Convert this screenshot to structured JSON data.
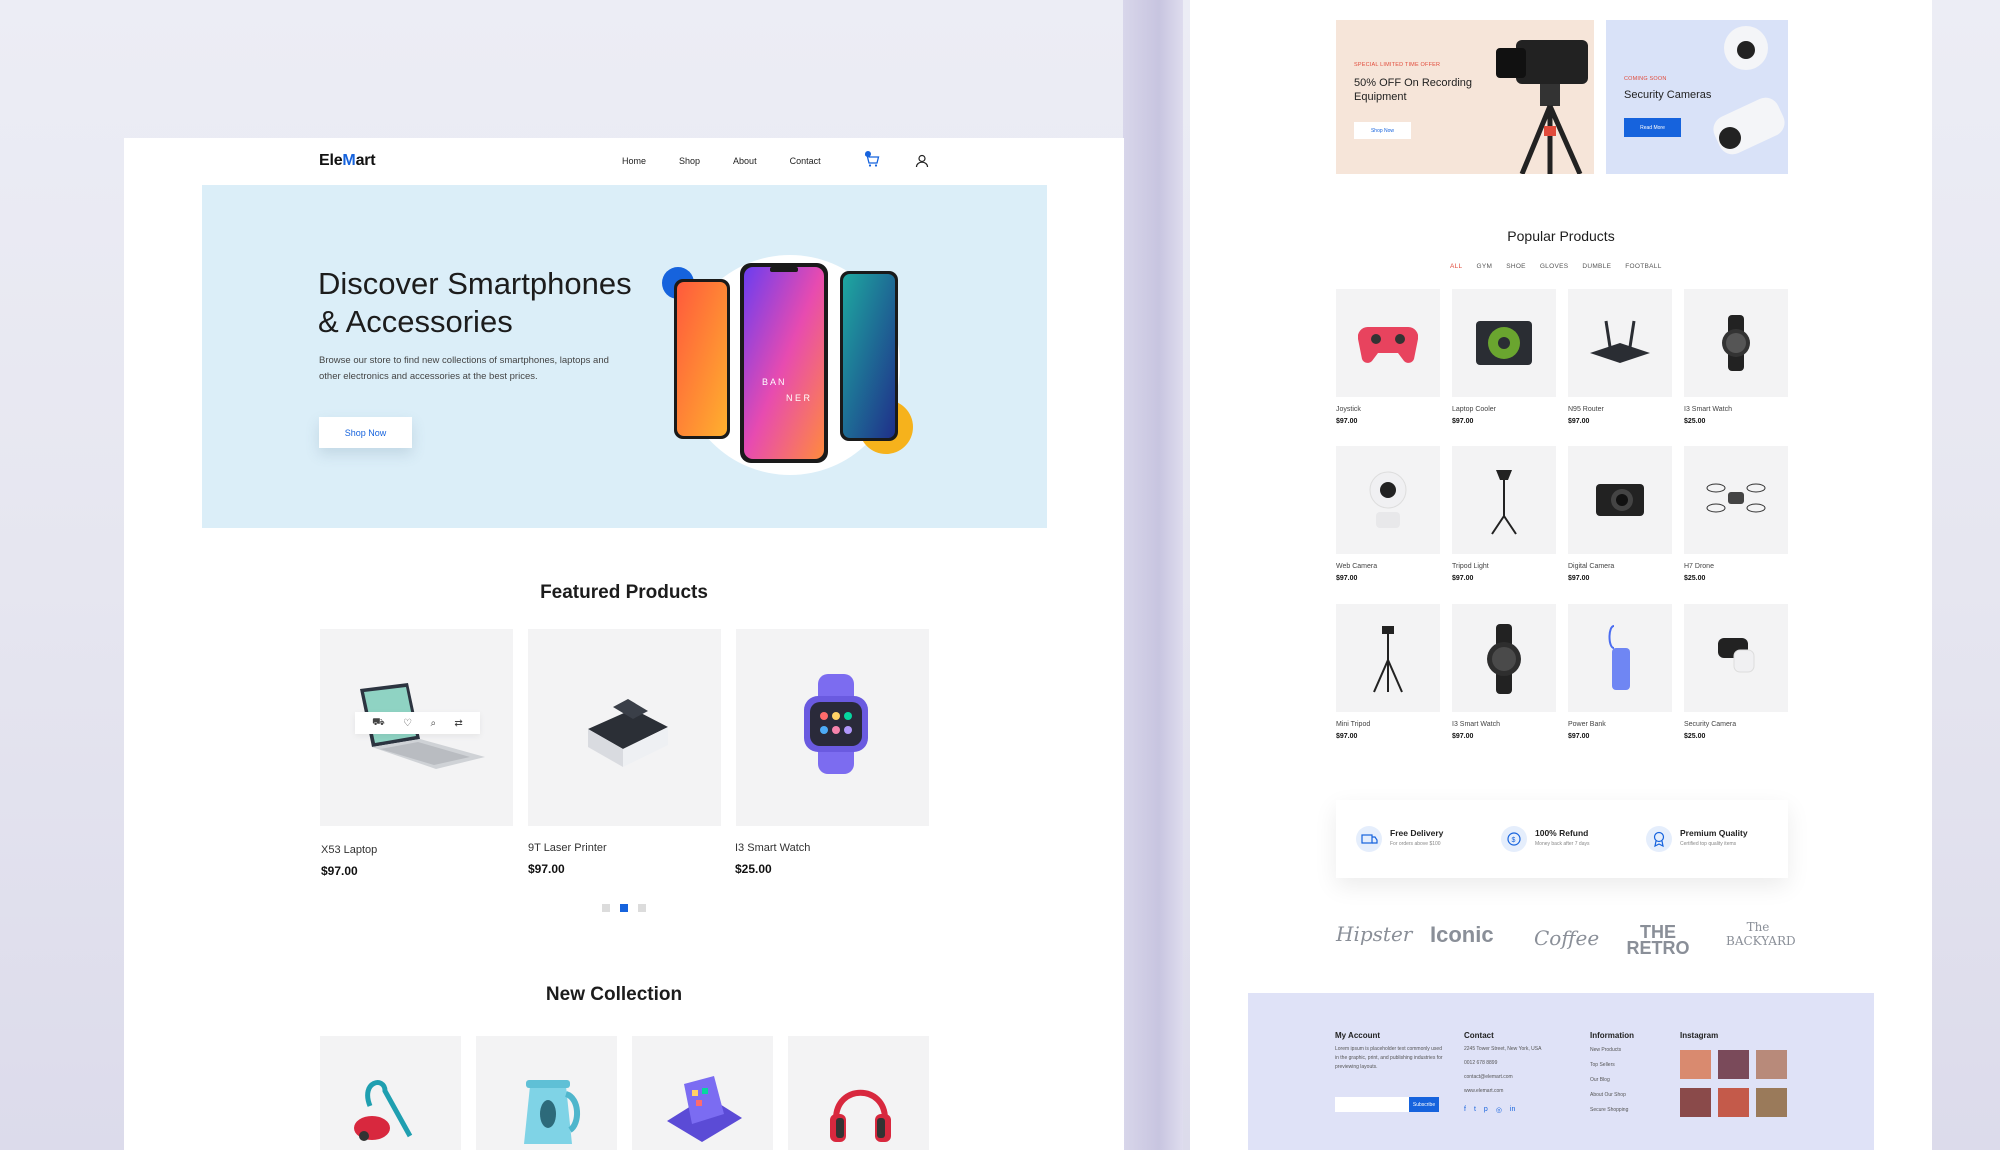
{
  "left": {
    "brand": {
      "pre": "Ele",
      "accent": "M",
      "post": "art"
    },
    "nav": [
      "Home",
      "Shop",
      "About",
      "Contact"
    ],
    "hero": {
      "title": "Discover Smartphones & Accessories",
      "subtitle": "Browse our store to find new collections of smartphones, laptops and other electronics and accessories at the best prices.",
      "cta": "Shop Now",
      "phone_text": "BANNER"
    },
    "featured": {
      "title": "Featured Products",
      "products": [
        {
          "name": "X53 Laptop",
          "price": "$97.00"
        },
        {
          "name": "9T Laser Printer",
          "price": "$97.00"
        },
        {
          "name": "I3 Smart Watch",
          "price": "$25.00"
        }
      ],
      "active_dot": 2
    },
    "new_collection": {
      "title": "New Collection"
    }
  },
  "right": {
    "promos": [
      {
        "kicker": "SPECIAL LIMITED TIME OFFER",
        "title": "50% OFF On Recording Equipment",
        "cta": "Shop Now"
      },
      {
        "kicker": "COMING SOON",
        "title": "Security Cameras",
        "cta": "Read More"
      }
    ],
    "popular": {
      "title": "Popular Products",
      "tabs": [
        "ALL",
        "GYM",
        "SHOE",
        "GLOVES",
        "DUMBLE",
        "FOOTBALL"
      ],
      "active_tab": "ALL",
      "products": [
        {
          "name": "Joystick",
          "price": "$97.00"
        },
        {
          "name": "Laptop Cooler",
          "price": "$97.00"
        },
        {
          "name": "N95 Router",
          "price": "$97.00"
        },
        {
          "name": "I3 Smart Watch",
          "price": "$25.00"
        },
        {
          "name": "Web Camera",
          "price": "$97.00"
        },
        {
          "name": "Tripod Light",
          "price": "$97.00"
        },
        {
          "name": "Digital Camera",
          "price": "$97.00"
        },
        {
          "name": "H7 Drone",
          "price": "$25.00"
        },
        {
          "name": "Mini Tripod",
          "price": "$97.00"
        },
        {
          "name": "I3 Smart Watch",
          "price": "$97.00"
        },
        {
          "name": "Power Bank",
          "price": "$97.00"
        },
        {
          "name": "Security Camera",
          "price": "$25.00"
        }
      ]
    },
    "features": [
      {
        "title": "Free Delivery",
        "sub": "For orders above $100"
      },
      {
        "title": "100% Refund",
        "sub": "Money back after 7 days"
      },
      {
        "title": "Premium Quality",
        "sub": "Certified top quality items"
      }
    ],
    "brands": [
      "Hipster",
      "Iconic",
      "Coffee",
      "THE RETRO",
      "The BACKYARD"
    ],
    "footer": {
      "account": {
        "title": "My Account",
        "text": "Lorem ipsum is placeholder text commonly used in the graphic, print, and publishing industries for previewing layouts.",
        "subscribe": "Subscribe"
      },
      "contact": {
        "title": "Contact",
        "lines": [
          "2245 Tower Street, New York, USA",
          "0012 678 8899",
          "contact@elemart.com",
          "www.elemart.com"
        ]
      },
      "information": {
        "title": "Information",
        "links": [
          "New Products",
          "Top Sellers",
          "Our Blog",
          "About Our Shop",
          "Secure Shopping"
        ]
      },
      "instagram": {
        "title": "Instagram"
      }
    }
  },
  "colors": {
    "accent": "#1663dd",
    "hero_bg": "#dbeef8",
    "promo_red": "#e14b3b",
    "footer_bg": "#dfe2f7"
  }
}
